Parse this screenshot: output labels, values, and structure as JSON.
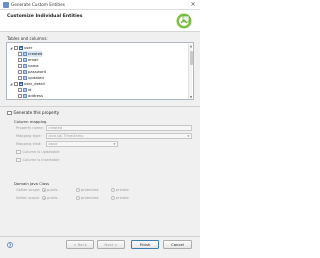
{
  "window": {
    "title": "Generate Custom Entities"
  },
  "header": {
    "heading": "Customize Individual Entities"
  },
  "tables_section": {
    "label": "Tables and columns:"
  },
  "tree": {
    "rows": [
      {
        "label": "user",
        "level": 0,
        "kind": "table",
        "expanded": true
      },
      {
        "label": "created",
        "level": 1,
        "kind": "column",
        "selected": true
      },
      {
        "label": "email",
        "level": 1,
        "kind": "column"
      },
      {
        "label": "name",
        "level": 1,
        "kind": "column"
      },
      {
        "label": "password",
        "level": 1,
        "kind": "column"
      },
      {
        "label": "updated",
        "level": 1,
        "kind": "column"
      },
      {
        "label": "user_detail",
        "level": 0,
        "kind": "table",
        "expanded": true
      },
      {
        "label": "id",
        "level": 1,
        "kind": "column"
      },
      {
        "label": "address",
        "level": 1,
        "kind": "column"
      }
    ]
  },
  "generate": {
    "label": "Generate this property"
  },
  "column_mapping": {
    "label": "Column mapping",
    "property_name": {
      "label": "Property name:",
      "value": "created"
    },
    "mapping_type": {
      "label": "Mapping type:",
      "value": "java.sql.Timestamp"
    },
    "mapping_kind": {
      "label": "Mapping kind:",
      "value": "basic"
    },
    "updatable": {
      "label": "Column is updatable"
    },
    "insertable": {
      "label": "Column is insertable"
    }
  },
  "domain_class": {
    "label": "Domain Java Class",
    "getter": {
      "label": "Getter scope:",
      "options": [
        "public",
        "protected",
        "private"
      ],
      "selected": "public"
    },
    "setter": {
      "label": "Setter scope:",
      "options": [
        "public",
        "protected",
        "private"
      ],
      "selected": "public"
    }
  },
  "buttons": {
    "help": "?",
    "back": "< Back",
    "next": "Next >",
    "finish": "Finish",
    "cancel": "Cancel"
  },
  "colors": {
    "selection": "#d9e6f7",
    "logo_green": "#7cc142",
    "accent_blue": "#3c7fb1"
  }
}
